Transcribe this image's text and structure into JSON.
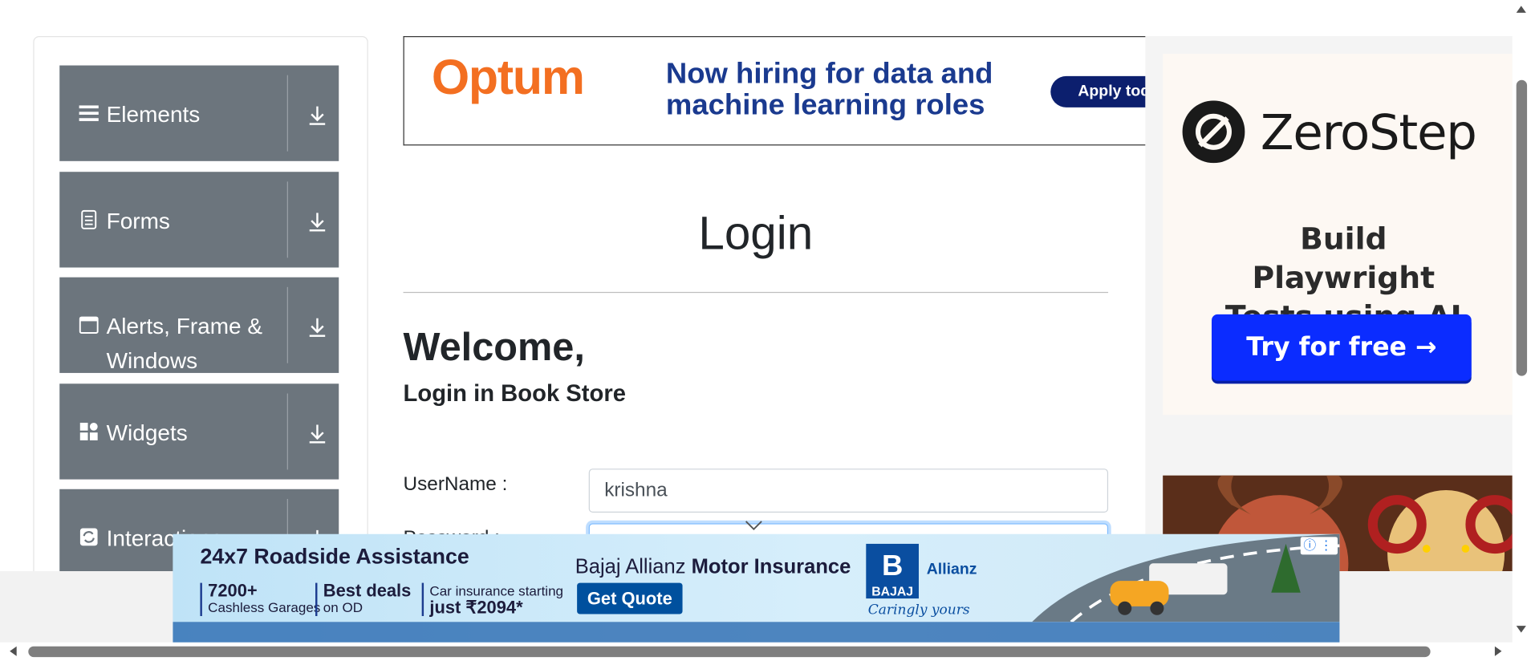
{
  "sidebar": {
    "items": [
      {
        "label": "Elements",
        "icon": "hamburger-icon"
      },
      {
        "label": "Forms",
        "icon": "document-icon"
      },
      {
        "label": "Alerts, Frame & Windows",
        "icon": "window-icon"
      },
      {
        "label": "Widgets",
        "icon": "widgets-icon"
      },
      {
        "label": "Interactions",
        "icon": "sync-icon"
      }
    ]
  },
  "top_ad": {
    "brand": "Optum",
    "headline": "Now hiring for data and machine learning roles",
    "cta": "Apply tod"
  },
  "main": {
    "title": "Login",
    "welcome": "Welcome,",
    "subtitle": "Login in Book Store",
    "username_label": "UserName :",
    "username_value": "krishna",
    "password_label": "Password :"
  },
  "right_ad": {
    "brand": "ZeroStep",
    "tagline": "Build Playwright Tests using AI",
    "cta": "Try for free →"
  },
  "bottom_ad": {
    "headline": "24x7 Roadside Assistance",
    "stat1_big": "7200+",
    "stat1_small": "Cashless Garages",
    "stat2_big": "Best deals",
    "stat2_small": "on OD",
    "stat3_small": "Car insurance starting",
    "stat3_big": "just ₹2094*",
    "brand_prefix": "Bajaj Allianz ",
    "brand_bold": "Motor Insurance",
    "cta": "Get Quote",
    "logo": "BAJAJ",
    "partner": "Allianz",
    "slogan": "Caringly yours"
  },
  "colors": {
    "menu_bg": "#6c757d",
    "optum_orange": "#f36f21",
    "optum_navy": "#1a3a8f",
    "zerostep_button": "#0b2cff",
    "focus_border": "#80bdff"
  }
}
